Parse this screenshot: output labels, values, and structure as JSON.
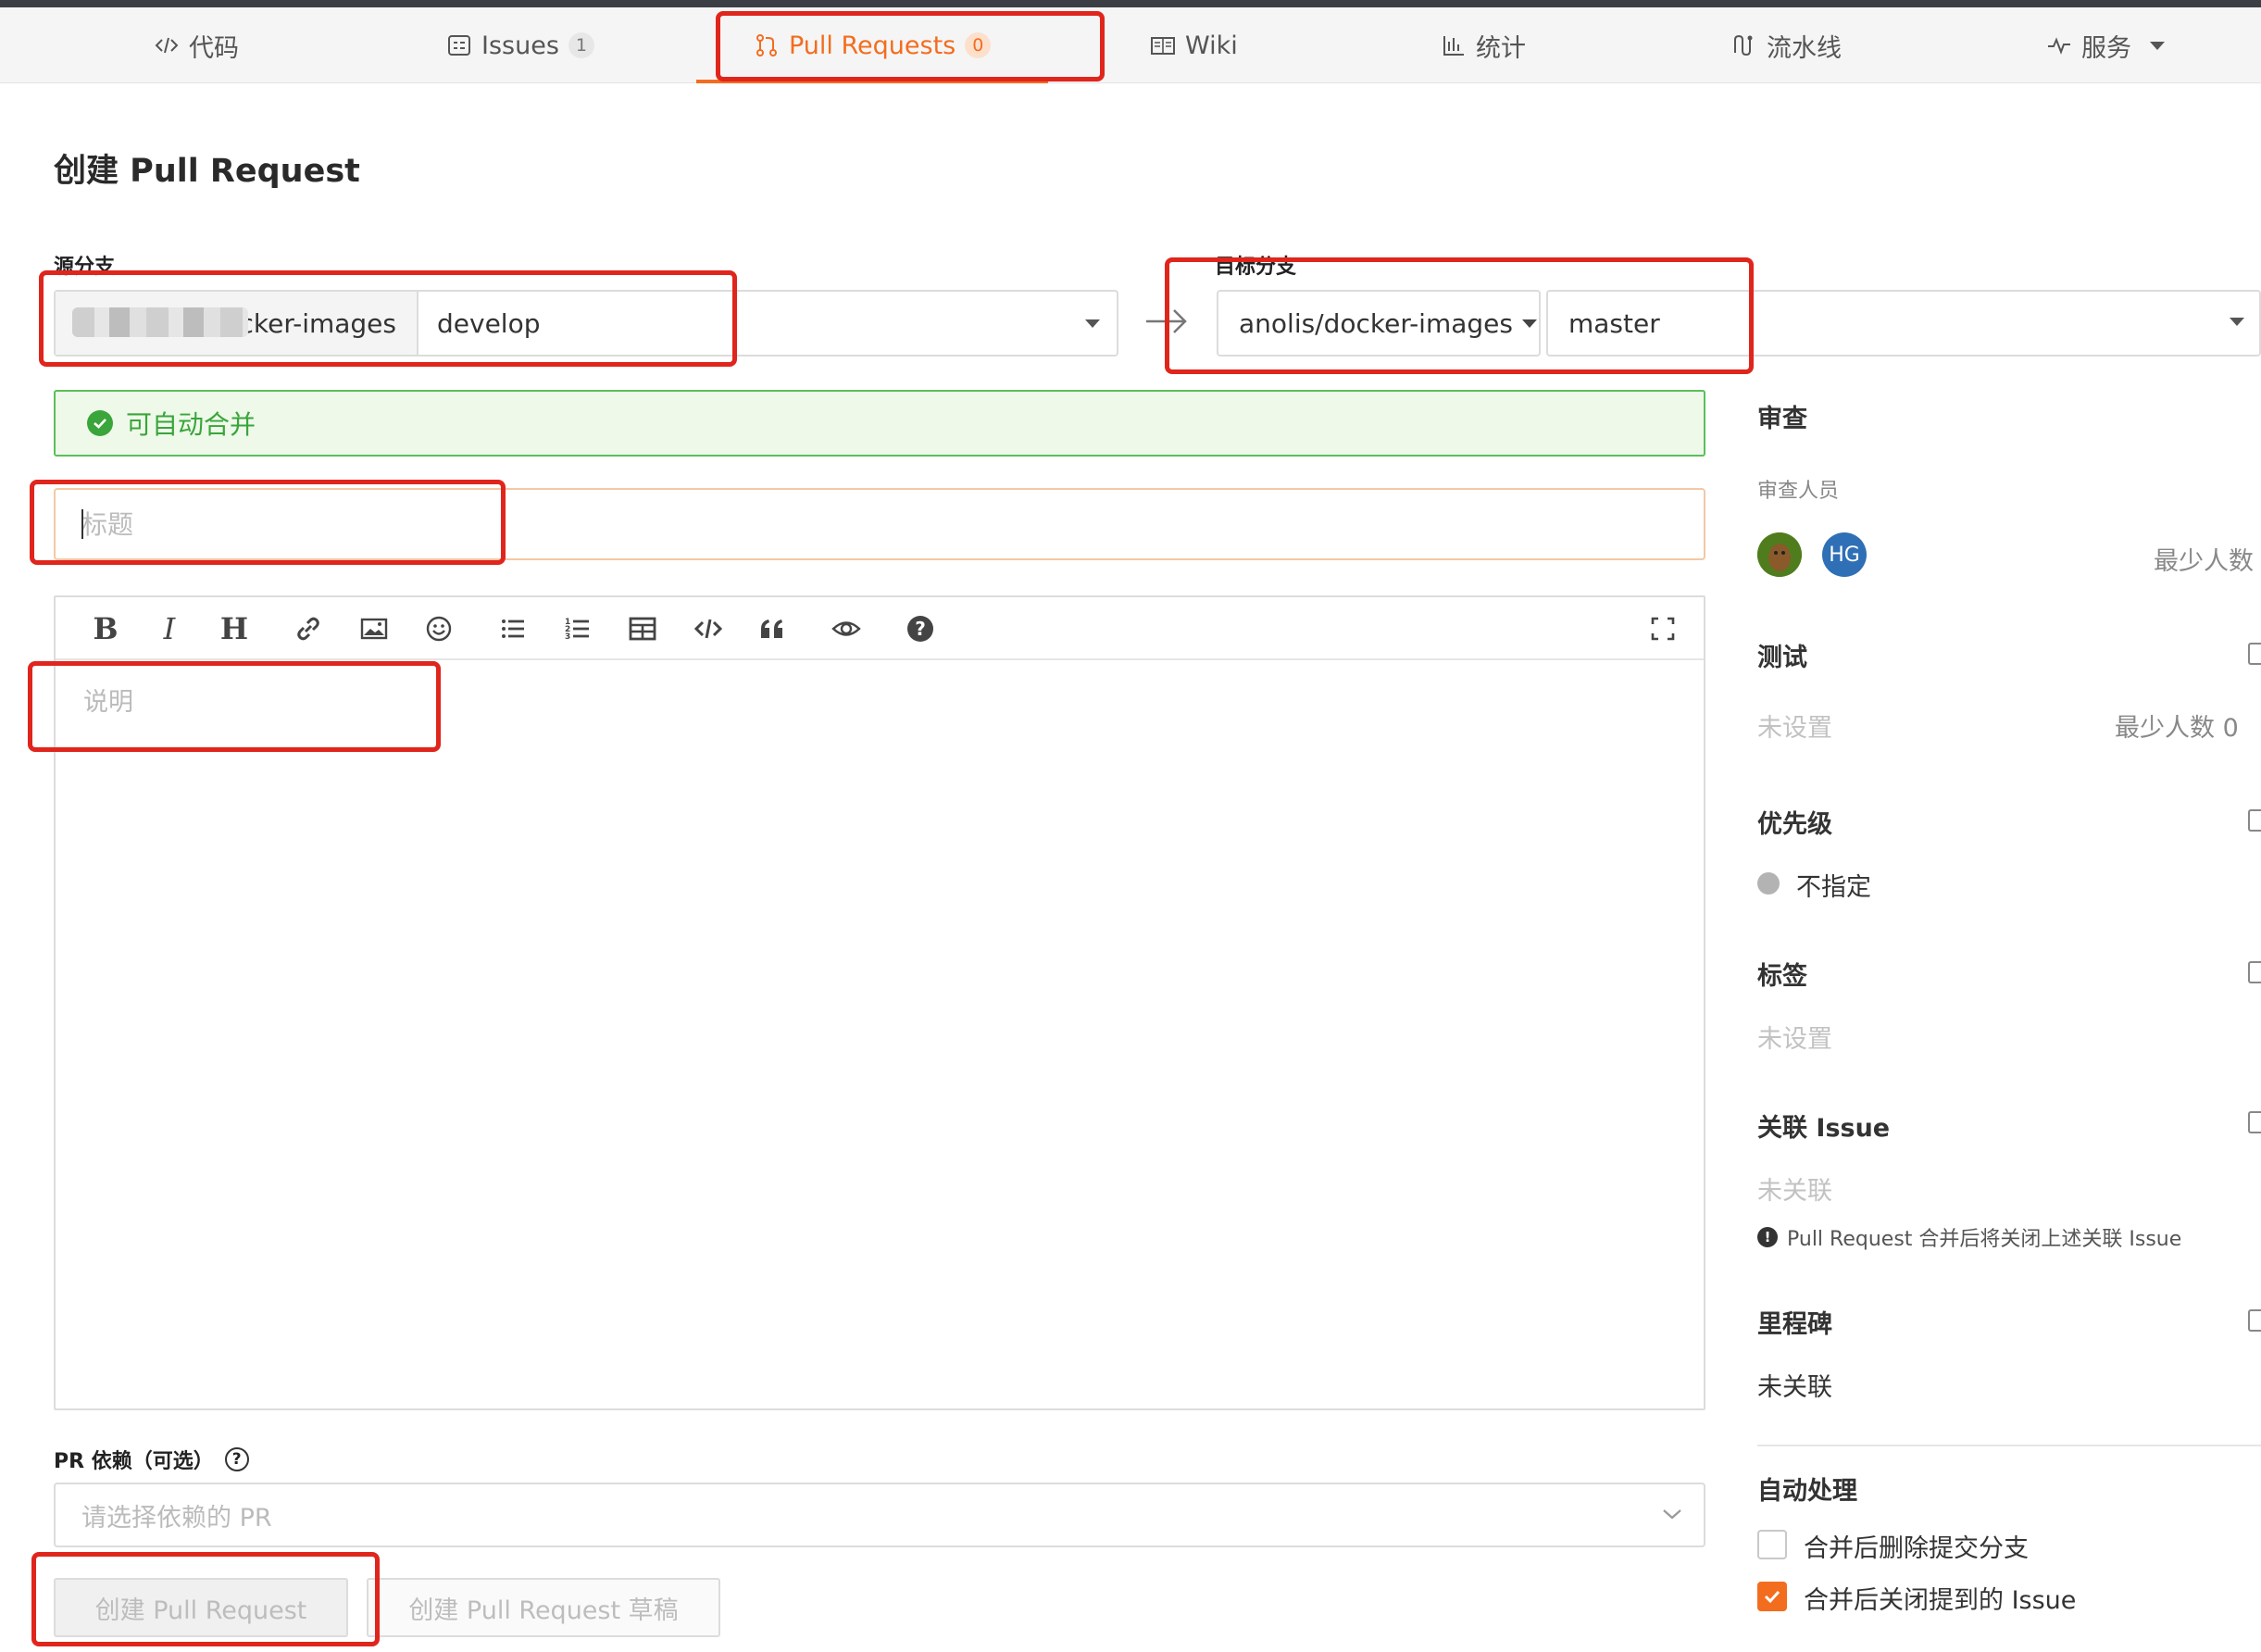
{
  "nav": {
    "tabs": [
      {
        "label": "代码",
        "icon": "code-icon"
      },
      {
        "label": "Issues",
        "icon": "issues-icon",
        "count": "1"
      },
      {
        "label": "Pull Requests",
        "icon": "pull-request-icon",
        "count": "0",
        "active": true
      },
      {
        "label": "Wiki",
        "icon": "wiki-icon"
      },
      {
        "label": "统计",
        "icon": "chart-icon"
      },
      {
        "label": "流水线",
        "icon": "pipeline-icon"
      },
      {
        "label": "服务",
        "icon": "pulse-icon",
        "dropdown": true
      }
    ]
  },
  "page_title": "创建 Pull Request",
  "source": {
    "label": "源分支",
    "repo_visible": "cker-images",
    "branch": "develop"
  },
  "target": {
    "label": "目标分支",
    "repo": "anolis/docker-images",
    "branch": "master"
  },
  "merge_status": "可自动合并",
  "title_input": {
    "placeholder": "标题"
  },
  "description": {
    "placeholder": "说明"
  },
  "dependency": {
    "label": "PR 依赖（可选）",
    "placeholder": "请选择依赖的 PR"
  },
  "buttons": {
    "create": "创建 Pull Request",
    "create_draft": "创建 Pull Request 草稿"
  },
  "sidebar": {
    "review": {
      "heading": "审查",
      "reviewers_label": "审查人员",
      "reviewers": [
        {
          "initials": ""
        },
        {
          "initials": "HG"
        }
      ],
      "min_label": "最少人数"
    },
    "test": {
      "heading": "测试",
      "value": "未设置",
      "min_label": "最少人数 0"
    },
    "priority": {
      "heading": "优先级",
      "value": "不指定"
    },
    "labels": {
      "heading": "标签",
      "value": "未设置"
    },
    "issues": {
      "heading": "关联 Issue",
      "value": "未关联",
      "note": "Pull Request 合并后将关闭上述关联 Issue"
    },
    "milestone": {
      "heading": "里程碑",
      "value": "未关联"
    },
    "auto": {
      "heading": "自动处理",
      "options": [
        {
          "label": "合并后删除提交分支",
          "checked": false
        },
        {
          "label": "合并后关闭提到的 Issue",
          "checked": true
        }
      ]
    }
  },
  "colors": {
    "accent": "#f36d1f",
    "success": "#3aa53a",
    "highlight_box": "#e0251c"
  }
}
